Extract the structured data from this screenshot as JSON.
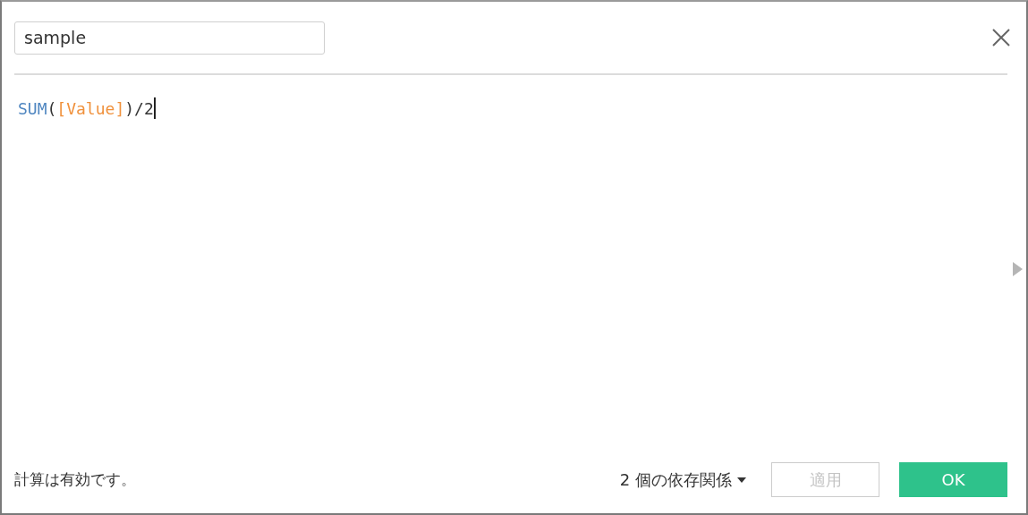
{
  "name_field": {
    "value": "sample"
  },
  "formula": {
    "tokens": [
      {
        "kind": "function",
        "text": "SUM"
      },
      {
        "kind": "operator",
        "text": "("
      },
      {
        "kind": "field",
        "text": "[Value]"
      },
      {
        "kind": "operator",
        "text": ")/2"
      }
    ]
  },
  "status": "計算は有効です。",
  "dependencies": {
    "label": "2 個の依存関係"
  },
  "buttons": [
    {
      "label": "適用",
      "kind": "secondary",
      "disabled": true
    },
    {
      "label": "OK",
      "kind": "primary",
      "disabled": false
    }
  ]
}
